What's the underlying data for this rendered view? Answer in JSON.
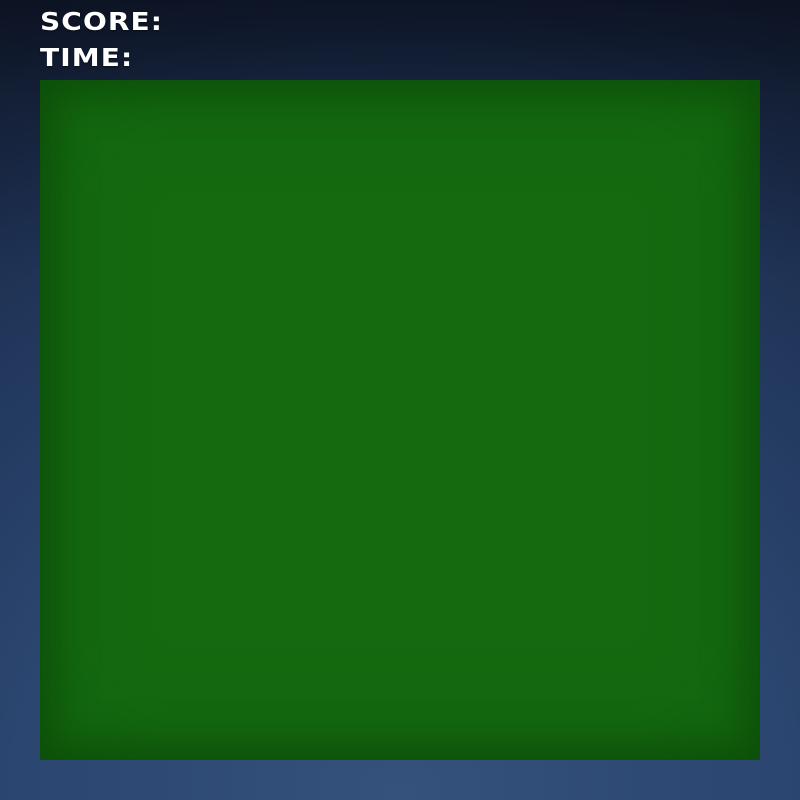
{
  "hud": {
    "score_label": "SCORE:",
    "time_label": "TIME:"
  },
  "colors": {
    "background": "#2b4670",
    "board": "#156a10",
    "hud_text": "#ffffff"
  }
}
